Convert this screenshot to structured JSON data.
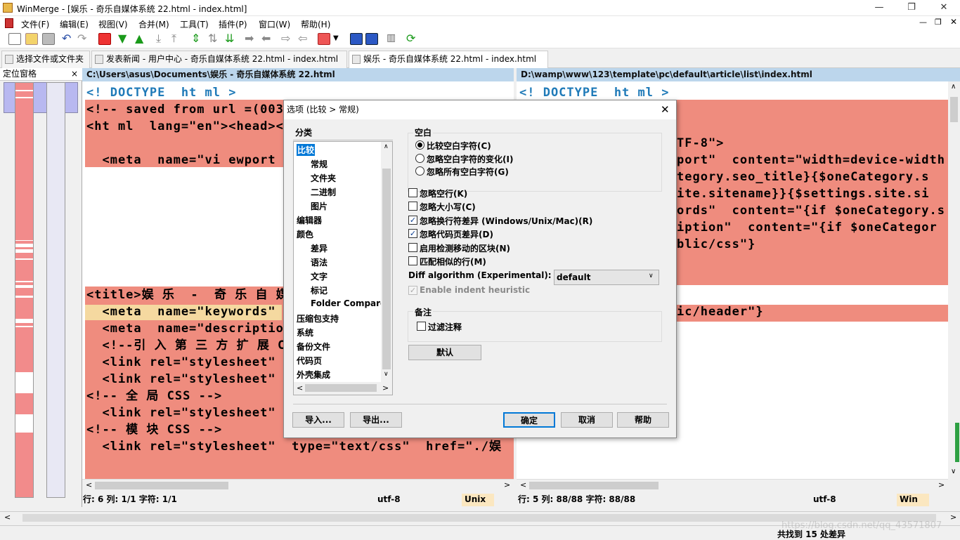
{
  "app": {
    "title": "WinMerge - [娱乐 - 奇乐自媒体系统 22.html - index.html]"
  },
  "menu": [
    "文件(F)",
    "编辑(E)",
    "视图(V)",
    "合并(M)",
    "工具(T)",
    "插件(P)",
    "窗口(W)",
    "帮助(H)"
  ],
  "tabs": [
    "选择文件或文件夹",
    "发表新闻 - 用户中心 - 奇乐自媒体系统 22.html - index.html",
    "娱乐 - 奇乐自媒体系统 22.html - index.html"
  ],
  "location_pane": {
    "title": "定位窗格",
    "close": "×"
  },
  "left": {
    "path": "C:\\Users\\asus\\Documents\\娱乐 - 奇乐自媒体系统 22.html",
    "lines": [
      "<! DOCTYPE  ht ml >",
      "<!-- saved from url =(003",
      "<ht ml  lang=\"en\"><head><m",
      "",
      "  <meta  name=\"vi ewport \"",
      "<title>娱 乐  -  奇 乐 自 媒",
      "  <meta  name=\"keywords\"",
      "  <meta  name=\"descriptio",
      "  <!--引 入 第 三 方 扩 展 CSS插",
      "  <link rel=\"stylesheet\"",
      "  <link rel=\"stylesheet\"",
      "<!-- 全 局 CSS -->",
      "  <link rel=\"stylesheet\"",
      "<!-- 模 块 CSS -->",
      "  <link rel=\"stylesheet\"  type=\"text/css\"  href=\"./娱"
    ]
  },
  "right": {
    "path": "D:\\wamp\\www\\123\\template\\pc\\default\\article\\list\\index.html",
    "lines": [
      "<! DOCTYPE  ht ml >",
      "TF-8\">",
      "port\"  content=\"width=device-width",
      "tegory.seo_title}{$oneCategory.s",
      "ite.sitename}}{$settings.site.si",
      "ords\"  content=\"{if $oneCategory.s",
      "iption\"  content=\"{if $oneCategor",
      "blic/css\"}",
      "ic/header\"}"
    ]
  },
  "status_left": {
    "pos": "行: 6  列: 1/1  字符: 1/1",
    "enc": "utf-8",
    "eol": "Unix"
  },
  "status_right": {
    "pos": "行: 5  列: 88/88  字符: 88/88",
    "enc": "utf-8",
    "eol": "Win"
  },
  "bottom_status": "共找到 15 处差异",
  "watermark": "https://blog.csdn.net/qq_43571807",
  "dialog": {
    "title": "选项 (比较 > 常规)",
    "category_label": "分类",
    "tree": [
      {
        "label": "比较",
        "level": 0,
        "selected": true
      },
      {
        "label": "常规",
        "level": 1
      },
      {
        "label": "文件夹",
        "level": 1
      },
      {
        "label": "二进制",
        "level": 1
      },
      {
        "label": "图片",
        "level": 1
      },
      {
        "label": "编辑器",
        "level": 0
      },
      {
        "label": "颜色",
        "level": 0
      },
      {
        "label": "差异",
        "level": 1
      },
      {
        "label": "语法",
        "level": 1
      },
      {
        "label": "文字",
        "level": 1
      },
      {
        "label": "标记",
        "level": 1
      },
      {
        "label": "Folder Compare",
        "level": 1
      },
      {
        "label": "压缩包支持",
        "level": 0
      },
      {
        "label": "系统",
        "level": 0
      },
      {
        "label": "备份文件",
        "level": 0
      },
      {
        "label": "代码页",
        "level": 0
      },
      {
        "label": "外壳集成",
        "level": 0
      }
    ],
    "whitespace_group": "空白",
    "radios": [
      {
        "label": "比较空白字符(C)",
        "checked": true
      },
      {
        "label": "忽略空白字符的变化(I)",
        "checked": false
      },
      {
        "label": "忽略所有空白字符(G)",
        "checked": false
      }
    ],
    "checks": [
      {
        "label": "忽略空行(K)",
        "checked": false
      },
      {
        "label": "忽略大小写(C)",
        "checked": false
      },
      {
        "label": "忽略换行符差异 (Windows/Unix/Mac)(R)",
        "checked": true
      },
      {
        "label": "忽略代码页差异(D)",
        "checked": true
      },
      {
        "label": "启用检测移动的区块(N)",
        "checked": false
      },
      {
        "label": "匹配相似的行(M)",
        "checked": false
      }
    ],
    "diff_algo_label": "Diff algorithm (Experimental):",
    "diff_algo_value": "default",
    "indent_label": "Enable indent heuristic",
    "comments_group": "备注",
    "filter_comments": "过滤注释",
    "default_btn": "默认",
    "import_btn": "导入...",
    "export_btn": "导出...",
    "ok_btn": "确定",
    "cancel_btn": "取消",
    "help_btn": "帮助"
  }
}
